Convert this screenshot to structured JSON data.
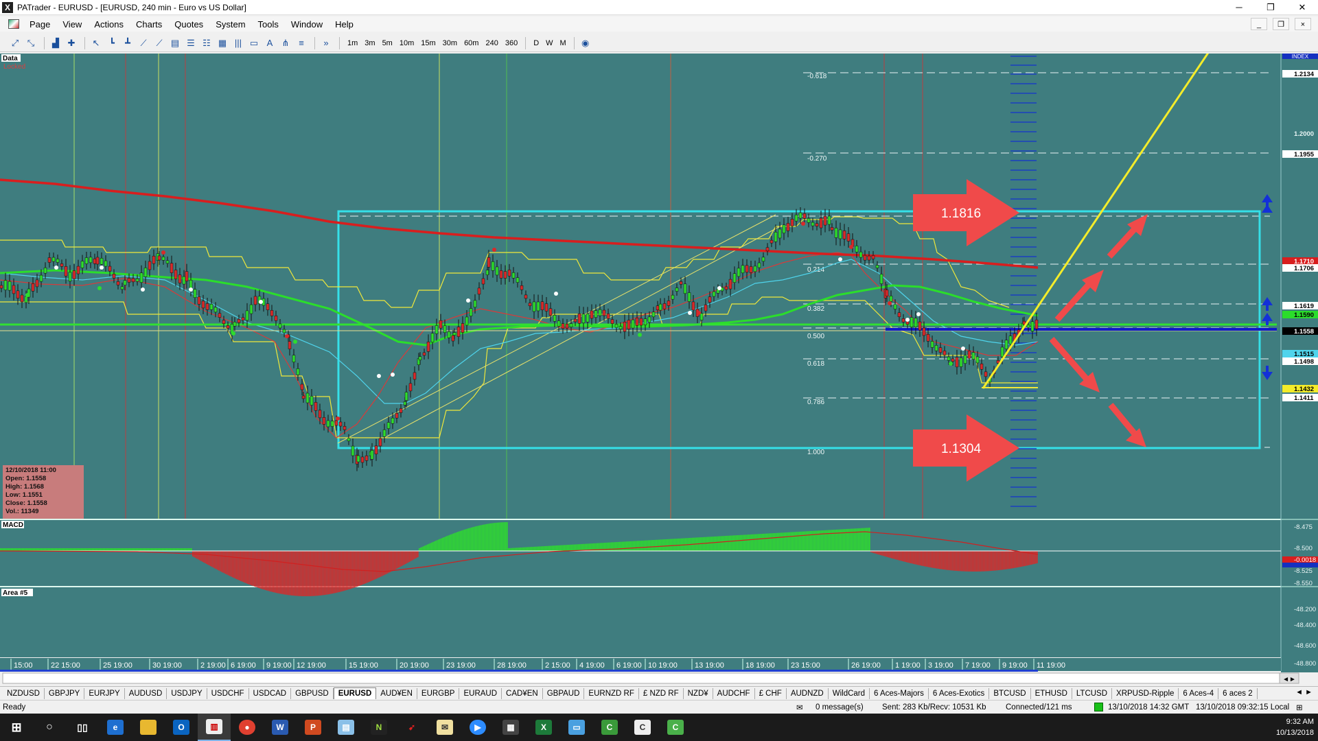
{
  "window": {
    "title": "PATrader - EURUSD - [EURUSD, 240 min - Euro vs US Dollar]",
    "app_glyph": "X",
    "minimize": "─",
    "restore": "❐",
    "close": "✕"
  },
  "menu": {
    "items": [
      "Page",
      "View",
      "Actions",
      "Charts",
      "Quotes",
      "System",
      "Tools",
      "Window",
      "Help"
    ],
    "mdi_min": "_",
    "mdi_restore": "❐",
    "mdi_close": "×"
  },
  "toolbar": {
    "timeframes": [
      "1m",
      "3m",
      "5m",
      "10m",
      "15m",
      "30m",
      "60m",
      "240",
      "360",
      "D",
      "W",
      "M"
    ],
    "more": "»"
  },
  "chart": {
    "panel_label": "Data",
    "locked_label": "Locked",
    "index_label": "INDEX",
    "macd_label": "MACD",
    "area_label": "Area #5",
    "info": {
      "date": "12/10/2018 11:00",
      "open": "Open: 1.1558",
      "high": "High: 1.1568",
      "low": "Low: 1.1551",
      "close": "Close: 1.1558",
      "vol": "Vol.: 11349"
    },
    "price_axis": [
      "1.2134",
      "1.2000",
      "1.1955",
      "1.1710",
      "1.1706",
      "1.1619",
      "1.1590",
      "1.1558",
      "1.1515",
      "1.1498",
      "1.1432",
      "1.1411"
    ],
    "fib_levels": [
      "-0.618",
      "-0.270",
      "0.214",
      "0.382",
      "0.500",
      "0.618",
      "0.786",
      "1.000"
    ],
    "callout_upper": "1.1816",
    "callout_lower": "1.1304",
    "macd_axis": [
      "-8.475",
      "-8.500",
      "-0.0018",
      "-8.525",
      "-8.550"
    ],
    "area_axis": [
      "-48.200",
      "-48.400",
      "-48.600",
      "-48.800"
    ],
    "time_axis": [
      "15:00",
      "22 15:00",
      "25 19:00",
      "30 19:00",
      "2 19:00",
      "6 19:00",
      "9 19:00",
      "12 19:00",
      "15 19:00",
      "20 19:00",
      "23 19:00",
      "28 19:00",
      "2 15:00",
      "4 19:00",
      "6 19:00",
      "10 19:00",
      "13 19:00",
      "18 19:00",
      "23 15:00",
      "26 19:00",
      "1 19:00",
      "3 19:00",
      "7 19:00",
      "9 19:00",
      "11 19:00"
    ],
    "colors": {
      "background": "#3f7d7f",
      "box": "#35e0e8",
      "callout": "#f04a4a",
      "ma_red": "#d81e1e",
      "ma_green": "#2bdd2b",
      "trend": "#f4ec2a",
      "level_blue": "#0f19c8"
    }
  },
  "tabs": {
    "items": [
      "NZDUSD",
      "GBPJPY",
      "EURJPY",
      "AUDUSD",
      "USDJPY",
      "USDCHF",
      "USDCAD",
      "GBPUSD",
      "EURUSD",
      "AUD¥EN",
      "EURGBP",
      "EURAUD",
      "CAD¥EN",
      "GBPAUD",
      "EURNZD RF",
      "£ NZD RF",
      "NZD¥",
      "AUDCHF",
      "£ CHF",
      "AUDNZD",
      "WildCard",
      "6 Aces-Majors",
      "6 Aces-Exotics",
      "BTCUSD",
      "ETHUSD",
      "LTCUSD",
      "XRPUSD-Ripple",
      "6 Aces-4",
      "6 aces 2"
    ],
    "active": "EURUSD",
    "nav": "◄ ►"
  },
  "status": {
    "ready": "Ready",
    "messages": "0 message(s)",
    "traffic": "Sent: 283 Kb/Recv: 10531 Kb",
    "connection": "Connected/121 ms",
    "gmt": "13/10/2018 14:32 GMT",
    "local": "13/10/2018 09:32:15 Local"
  },
  "taskbar": {
    "time": "9:32 AM",
    "date": "10/13/2018"
  }
}
